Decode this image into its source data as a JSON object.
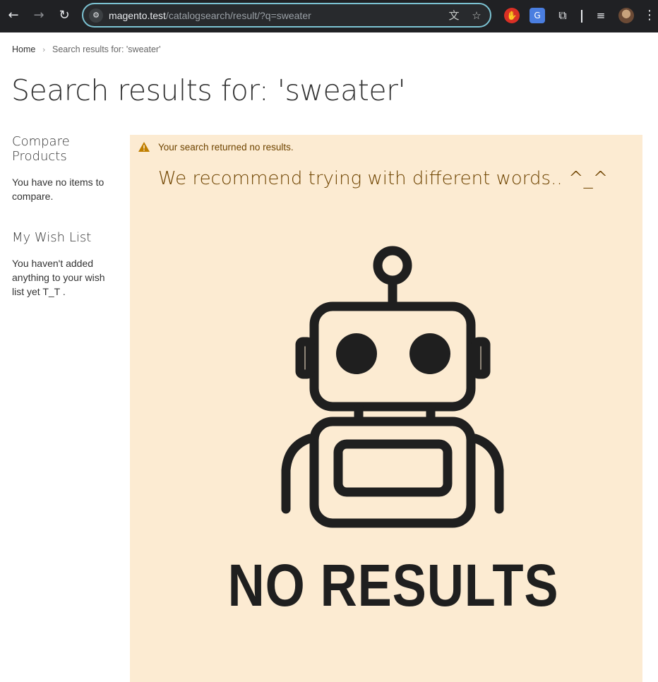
{
  "browser": {
    "url_host": "magento.test",
    "url_path": "/catalogsearch/result/?q=sweater"
  },
  "breadcrumb": {
    "home": "Home",
    "current": "Search results for: 'sweater'"
  },
  "page_title": "Search results for: 'sweater'",
  "sidebar": {
    "compare_title": "Compare Products",
    "compare_text": "You have no items to compare.",
    "wishlist_title": "My Wish List",
    "wishlist_text": "You haven't added anything to your wish list yet T_T ."
  },
  "notice": {
    "message": "Your search returned no results.",
    "recommendation": "We recommend trying with different words.. ^_^",
    "image_text": "NO RESULTS"
  },
  "colors": {
    "notice_bg": "#fcebd2",
    "notice_text": "#6f4400",
    "warning": "#c07f00"
  }
}
